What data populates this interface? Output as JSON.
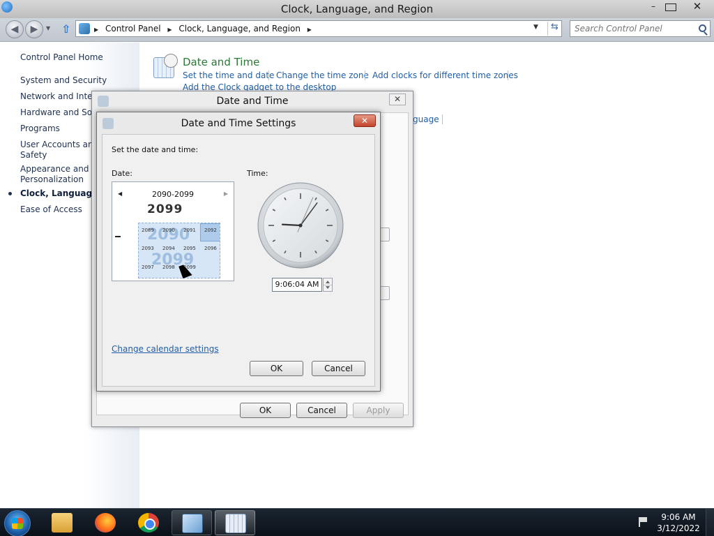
{
  "window": {
    "title": "Clock, Language, and Region",
    "controls": {
      "minimize": "–",
      "close": "✕"
    }
  },
  "address_bar": {
    "breadcrumbs": [
      "Control Panel",
      "Clock, Language, and Region"
    ],
    "search_placeholder": "Search Control Panel"
  },
  "sidebar": {
    "items": [
      {
        "label": "Control Panel Home"
      },
      {
        "label": "System and Security"
      },
      {
        "label": "Network and Intern"
      },
      {
        "label": "Hardware and Soun"
      },
      {
        "label": "Programs"
      },
      {
        "label": "User Accounts and",
        "label2": "Safety"
      },
      {
        "label": "Appearance and",
        "label2": "Personalization"
      },
      {
        "label": "Clock, Language, a",
        "current": true
      },
      {
        "label": "Ease of Access"
      }
    ]
  },
  "main": {
    "date_time": {
      "heading": "Date and Time",
      "links": [
        "Set the time and date",
        "Change the time zone",
        "Add clocks for different time zones",
        "Add the Clock gadget to the desktop"
      ]
    },
    "language_link_fragment": "guage"
  },
  "date_time_dialog": {
    "title": "Date and Time",
    "close": "✕",
    "buttons": {
      "ok": "OK",
      "cancel": "Cancel",
      "apply": "Apply"
    }
  },
  "settings_dialog": {
    "title": "Date and Time Settings",
    "close": "✕",
    "instruction": "Set the date and time:",
    "date_label": "Date:",
    "time_label": "Time:",
    "calendar": {
      "range": "2090-2099",
      "big_year": "2099",
      "ghost_years": [
        "2090",
        "2099"
      ],
      "cells": [
        "2089",
        "2090",
        "2091",
        "2092",
        "2093",
        "2094",
        "2095",
        "2096",
        "2097",
        "2098",
        "2099"
      ]
    },
    "time_value": "9:06:04 AM",
    "clock": {
      "hour": 9,
      "minute": 6,
      "second": 4
    },
    "calendar_settings_link": "Change calendar settings",
    "buttons": {
      "ok": "OK",
      "cancel": "Cancel"
    }
  },
  "taskbar": {
    "pinned": [
      {
        "name": "Windows Explorer",
        "icon": "folder-icon"
      },
      {
        "name": "Firefox",
        "icon": "firefox-icon"
      },
      {
        "name": "Google Chrome",
        "icon": "chrome-icon"
      },
      {
        "name": "Control Panel",
        "icon": "control-panel-icon"
      },
      {
        "name": "Date and Time",
        "icon": "calendar-clock-icon"
      }
    ],
    "clock_time": "9:06 AM",
    "clock_date": "3/12/2022"
  }
}
